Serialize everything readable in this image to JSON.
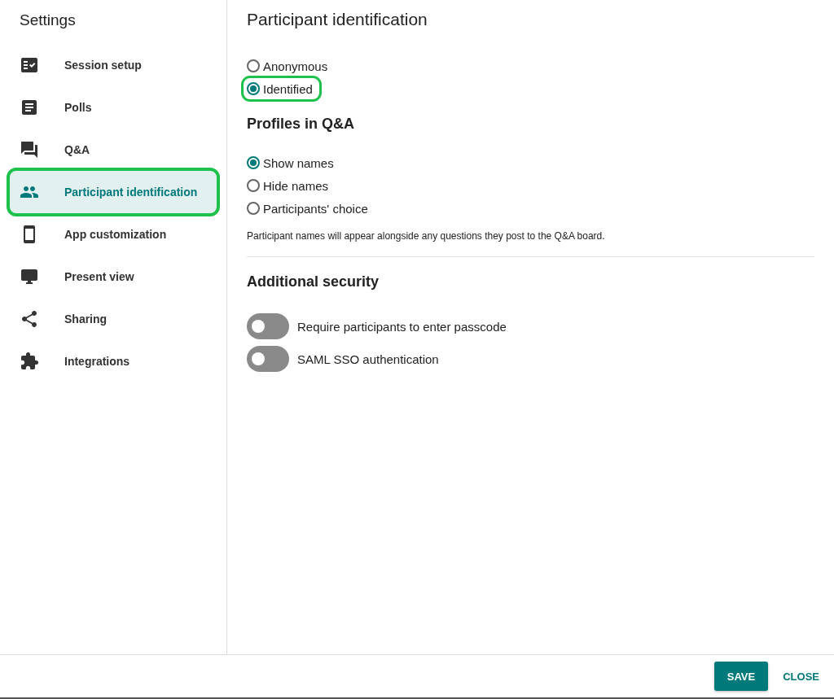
{
  "sidebar": {
    "title": "Settings",
    "items": [
      {
        "label": "Session setup",
        "selected": false,
        "highlighted": false
      },
      {
        "label": "Polls",
        "selected": false,
        "highlighted": false
      },
      {
        "label": "Q&A",
        "selected": false,
        "highlighted": false
      },
      {
        "label": "Participant identification",
        "selected": true,
        "highlighted": true
      },
      {
        "label": "App customization",
        "selected": false,
        "highlighted": false
      },
      {
        "label": "Present view",
        "selected": false,
        "highlighted": false
      },
      {
        "label": "Sharing",
        "selected": false,
        "highlighted": false
      },
      {
        "label": "Integrations",
        "selected": false,
        "highlighted": false
      }
    ]
  },
  "main": {
    "title": "Participant identification",
    "identification": [
      {
        "label": "Anonymous",
        "selected": false,
        "highlighted": false
      },
      {
        "label": "Identified",
        "selected": true,
        "highlighted": true
      }
    ],
    "profiles": {
      "title": "Profiles in Q&A",
      "options": [
        {
          "label": "Show names",
          "selected": true,
          "highlighted": false
        },
        {
          "label": "Hide names",
          "selected": false,
          "highlighted": false
        },
        {
          "label": "Participants' choice",
          "selected": false,
          "highlighted": false
        }
      ],
      "note": "Participant names will appear alongside any questions they post to the Q&A board."
    },
    "security": {
      "title": "Additional security",
      "toggles": [
        {
          "label": "Require participants to enter passcode",
          "on": false
        },
        {
          "label": "SAML SSO authentication",
          "on": false
        }
      ]
    }
  },
  "footer": {
    "buttons": [
      {
        "label": "SAVE",
        "kind": "primary"
      },
      {
        "label": "CLOSE",
        "kind": "text"
      }
    ]
  }
}
